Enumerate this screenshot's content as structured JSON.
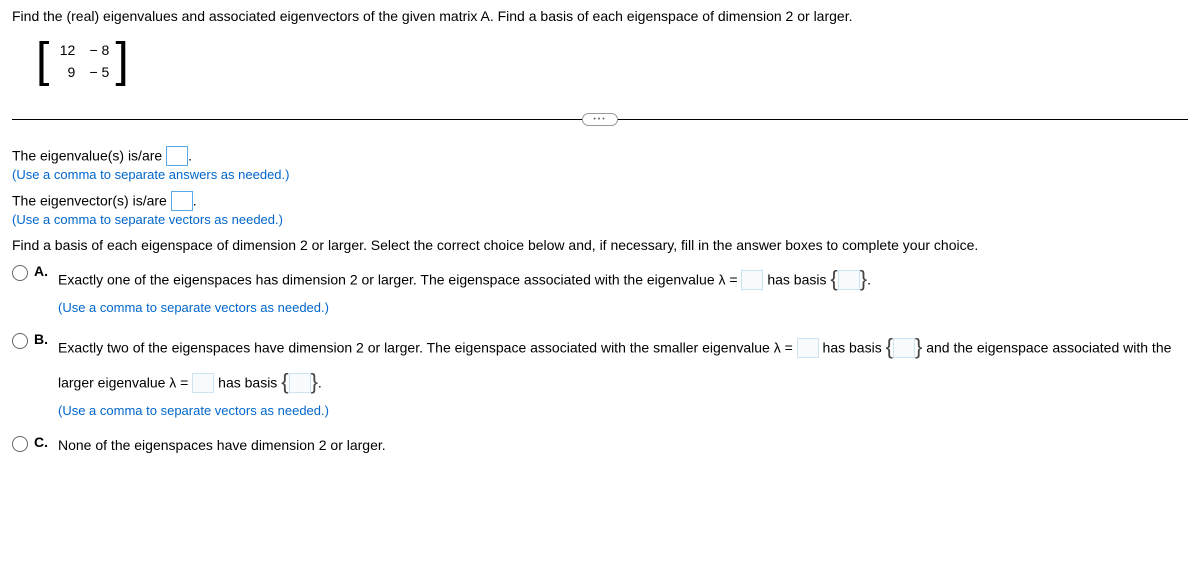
{
  "problem": "Find the (real) eigenvalues and associated eigenvectors of the given matrix A. Find a basis of each eigenspace of dimension 2 or larger.",
  "matrix": {
    "a11": "12",
    "a12": "− 8",
    "a21": "9",
    "a22": "− 5"
  },
  "eigenvalue_prompt_prefix": "The eigenvalue(s) is/are ",
  "eigenvalue_prompt_suffix": ".",
  "eigenvalue_hint": "(Use a comma to separate answers as needed.)",
  "eigenvector_prompt_prefix": "The eigenvector(s) is/are ",
  "eigenvector_prompt_suffix": ".",
  "eigenvector_hint": "(Use a comma to separate vectors as needed.)",
  "basis_prompt": "Find a basis of each eigenspace of dimension 2 or larger. Select the correct choice below and, if necessary, fill in the answer boxes to complete your choice.",
  "choice_a": {
    "label": "A.",
    "text_1": "Exactly one of the eigenspaces has dimension 2 or larger. The eigenspace associated with the eigenvalue λ = ",
    "text_2": " has basis ",
    "text_3": ".",
    "hint": "(Use a comma to separate vectors as needed.)"
  },
  "choice_b": {
    "label": "B.",
    "text_1": "Exactly two of the eigenspaces have dimension 2 or larger. The eigenspace associated with the smaller eigenvalue λ = ",
    "text_2": " has basis ",
    "text_3": " and the eigenspace associated with the larger eigenvalue λ = ",
    "text_4": " has basis ",
    "text_5": ".",
    "hint": "(Use a comma to separate vectors as needed.)"
  },
  "choice_c": {
    "label": "C.",
    "text": "None of the eigenspaces have dimension 2 or larger."
  }
}
